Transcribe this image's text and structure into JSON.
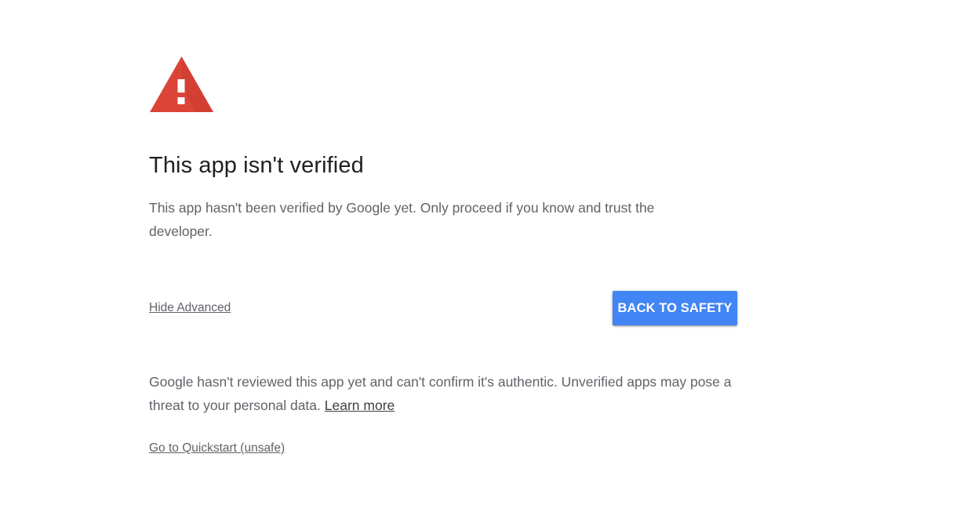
{
  "warning": {
    "icon": "warning-triangle-icon",
    "color": "#db4437"
  },
  "title": "This app isn't verified",
  "description": "This app hasn't been verified by Google yet. Only proceed if you know and trust the developer.",
  "actions": {
    "hide_advanced_label": "Hide Advanced",
    "back_button_label": "BACK TO SAFETY",
    "back_button_color": "#4285f4"
  },
  "advanced": {
    "details_text": "Google hasn't reviewed this app yet and can't confirm it's authentic. Unverified apps may pose a threat to your personal data.",
    "learn_more_label": "Learn more",
    "unsafe_link_label": "Go to Quickstart (unsafe)"
  }
}
